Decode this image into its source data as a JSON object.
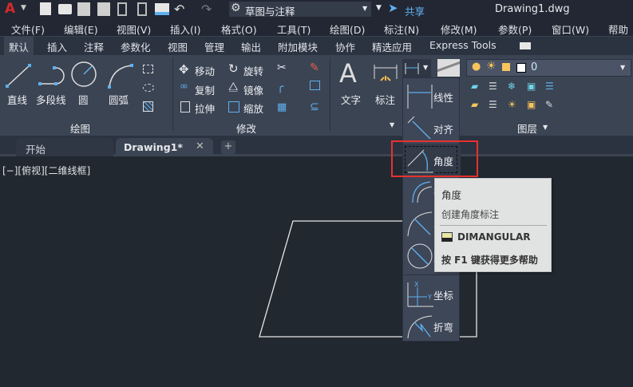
{
  "titlebar": {
    "workspace": "草图与注释",
    "share": "共享",
    "doc_title": "Drawing1.dwg"
  },
  "menu": [
    "文件(F)",
    "编辑(E)",
    "视图(V)",
    "插入(I)",
    "格式(O)",
    "工具(T)",
    "绘图(D)",
    "标注(N)",
    "修改(M)",
    "参数(P)",
    "窗口(W)",
    "帮助(H)"
  ],
  "ribbon_tabs": [
    "默认",
    "插入",
    "注释",
    "参数化",
    "视图",
    "管理",
    "输出",
    "附加模块",
    "协作",
    "精选应用",
    "Express Tools"
  ],
  "draw_panel": {
    "title": "绘图",
    "line": "直线",
    "polyline": "多段线",
    "circle": "圆",
    "arc": "圆弧"
  },
  "modify_panel": {
    "title": "修改",
    "move": "移动",
    "rotate": "旋转",
    "copy": "复制",
    "mirror": "镜像",
    "stretch": "拉伸",
    "scale": "缩放"
  },
  "annotation": {
    "text": "文字",
    "dim": "标注"
  },
  "layers_panel": {
    "title": "图层",
    "current_layer": "0"
  },
  "doc_tabs": {
    "start": "开始",
    "drawing": "Drawing1*"
  },
  "viewport_label": "[−][俯视][二维线框]",
  "flyout": [
    "线性",
    "对齐",
    "角度",
    "弧长",
    "半径",
    "直径",
    "坐标",
    "折弯"
  ],
  "tooltip": {
    "title": "角度",
    "desc": "创建角度标注",
    "command": "DIMANGULAR",
    "help": "按 F1 键获得更多帮助"
  },
  "colors": {
    "accent": "#5fb0ef",
    "highlight_box": "#e8312f",
    "app_red": "#d32b2b"
  }
}
